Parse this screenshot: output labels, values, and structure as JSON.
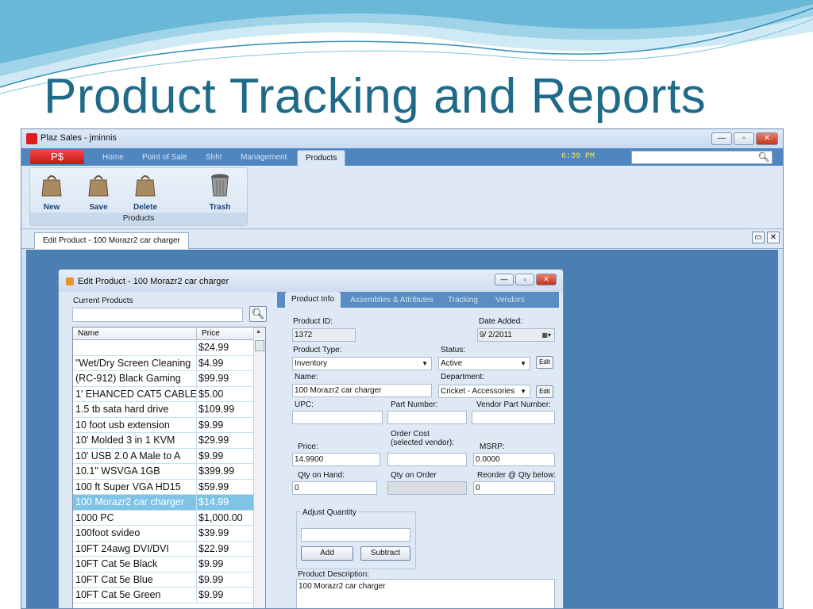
{
  "slide": {
    "title": "Product Tracking and Reports"
  },
  "window": {
    "title": "Plaz Sales - jminnis",
    "logo": "P$",
    "tabs": [
      "Home",
      "Point of Sale",
      "Shh!",
      "Management",
      "Products"
    ],
    "clock": "6:39 PM",
    "ribbon": {
      "buttons": [
        {
          "label": "New",
          "icon": "bag-icon"
        },
        {
          "label": "Save",
          "icon": "bag-icon"
        },
        {
          "label": "Delete",
          "icon": "bag-icon"
        },
        {
          "label": "Trash",
          "icon": "trash-icon"
        }
      ],
      "group_label": "Products"
    },
    "doc_tab": "Edit Product - 100 Morazr2 car charger"
  },
  "dialog": {
    "title": "Edit Product - 100 Morazr2 car charger",
    "current_products_label": "Current Products",
    "list": {
      "headers": [
        "Name",
        "Price"
      ],
      "rows": [
        {
          "name": "",
          "price": "$24.99"
        },
        {
          "name": "\"Wet/Dry Screen Cleaning",
          "price": "$4.99"
        },
        {
          "name": "(RC-912)  Black Gaming",
          "price": "$99.99"
        },
        {
          "name": "1' EHANCED CAT5 CABLE",
          "price": "$5.00"
        },
        {
          "name": "1.5 tb sata hard drive",
          "price": "$109.99"
        },
        {
          "name": "10 foot usb extension",
          "price": "$9.99"
        },
        {
          "name": "10' Molded 3 in 1 KVM",
          "price": "$29.99"
        },
        {
          "name": "10' USB 2.0 A Male to A",
          "price": "$9.99"
        },
        {
          "name": "10.1\" WSVGA 1GB",
          "price": "$399.99"
        },
        {
          "name": "100 ft Super VGA HD15",
          "price": "$59.99"
        },
        {
          "name": "100 Morazr2 car charger",
          "price": "$14.99",
          "selected": true
        },
        {
          "name": "1000 PC",
          "price": "$1,000.00"
        },
        {
          "name": "100foot svideo",
          "price": "$39.99"
        },
        {
          "name": "10FT 24awg DVI/DVI",
          "price": "$22.99"
        },
        {
          "name": "10FT Cat 5e Black",
          "price": "$9.99"
        },
        {
          "name": "10FT Cat 5e Blue",
          "price": "$9.99"
        },
        {
          "name": "10FT Cat 5e Green",
          "price": "$9.99"
        }
      ]
    },
    "tabs": [
      "Product Info",
      "Assemblies & Attributes",
      "Tracking",
      "Vendors"
    ],
    "form": {
      "product_id_label": "Product ID:",
      "product_id": "1372",
      "date_added_label": "Date Added:",
      "date_added": "9/ 2/2011",
      "product_type_label": "Product Type:",
      "product_type": "Inventory",
      "status_label": "Status:",
      "status": "Active",
      "edit_label": "Edit",
      "name_label": "Name:",
      "name": "100 Morazr2 car charger",
      "department_label": "Department:",
      "department": "Cricket - Accessories",
      "upc_label": "UPC:",
      "upc": "",
      "part_number_label": "Part Number:",
      "part_number": "",
      "vendor_part_label": "Vendor Part Number:",
      "vendor_part": "",
      "price_label": "Price:",
      "price": "14.9900",
      "order_cost_label_1": "Order Cost",
      "order_cost_label_2": "(selected vendor):",
      "order_cost": "",
      "msrp_label": "MSRP:",
      "msrp": "0.0000",
      "qty_on_hand_label": "Qty on Hand:",
      "qty_on_hand": "0",
      "qty_on_order_label": "Qty on Order",
      "qty_on_order": "",
      "reorder_label": "Reorder @ Qty below:",
      "reorder": "0",
      "adjust_label": "Adjust Quantity",
      "adjust_value": "",
      "add_label": "Add",
      "subtract_label": "Subtract",
      "description_label": "Product Description:",
      "description": "100 Morazr2 car charger"
    }
  },
  "colors": {
    "title": "#1f6a88",
    "workspace": "#4b7fb3",
    "ribbon_tab_bar": "#4f86c0",
    "selected_row": "#7fc3e6"
  }
}
